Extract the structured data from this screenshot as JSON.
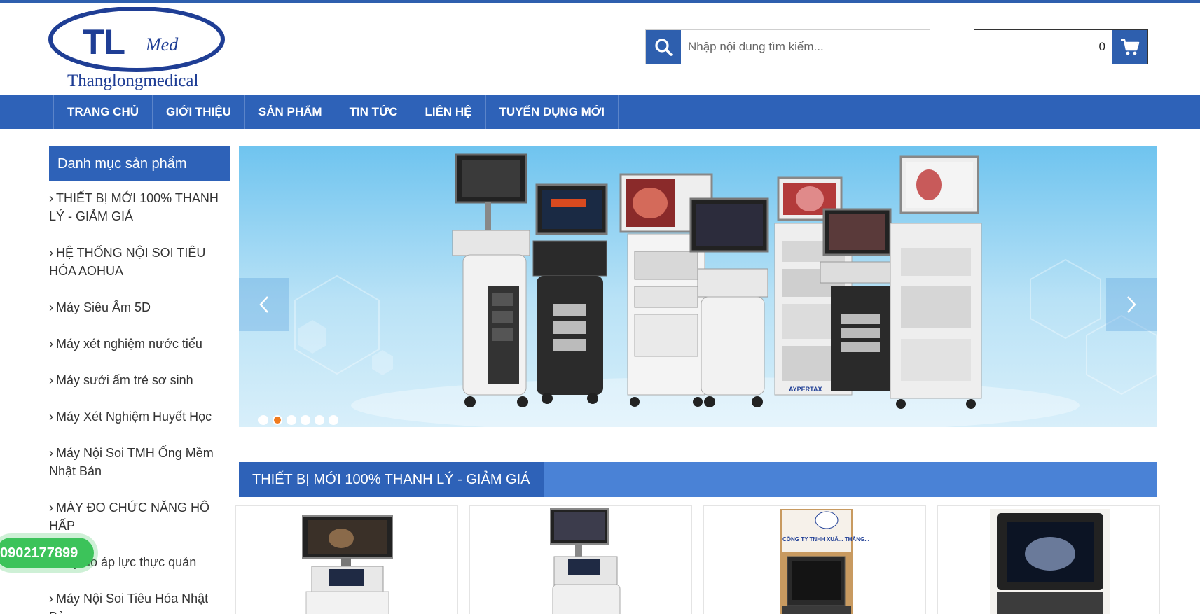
{
  "header": {
    "logo": {
      "initials": "TL",
      "script": "Med",
      "brand": "Thanglongmedical"
    },
    "search": {
      "placeholder": "Nhập nội dung tìm kiếm...",
      "icon": "search-icon"
    },
    "cart": {
      "count": "0",
      "icon": "cart-icon"
    }
  },
  "nav": {
    "items": [
      "TRANG CHỦ",
      "GIỚI THIỆU",
      "SẢN PHẨM",
      "TIN TỨC",
      "LIÊN HỆ",
      "TUYỂN DỤNG MỚI"
    ]
  },
  "sidebar": {
    "title": "Danh mục sản phẩm",
    "items": [
      "THIẾT BỊ MỚI 100% THANH LÝ - GIẢM GIÁ",
      "HỆ THỐNG NỘI SOI TIÊU HÓA AOHUA",
      "Máy Siêu Âm 5D",
      "Máy xét nghiệm nước tiểu",
      "Máy sưởi ấm trẻ sơ sinh",
      "Máy Xét Nghiệm Huyết Học",
      "Máy Nội Soi TMH Ống Mềm Nhật Bản",
      "MÁY ĐO CHỨC NĂNG HÔ HẤP",
      "Máy đo áp lực thực quản",
      "Máy Nội Soi Tiêu Hóa Nhật Bản"
    ]
  },
  "banner": {
    "slide_count": 6,
    "active_slide": 2,
    "brand_mark": "AYPERTAX"
  },
  "section": {
    "title": "THIẾT BỊ MỚI 100% THANH LÝ - GIẢM GIÁ"
  },
  "products": [
    {
      "image": "ultrasound-cart-monitor"
    },
    {
      "image": "ultrasound-cart-compact"
    },
    {
      "image": "laptop-ultrasound-box",
      "sign_text": "CÔNG TY TNHH XUẤ... THĂNG..."
    },
    {
      "image": "portable-ultrasound-screen"
    }
  ],
  "phone": {
    "number": "0902177899"
  },
  "colors": {
    "primary": "#2e62b8",
    "accent": "#4a82d6",
    "phone_green": "#3cc35a",
    "dot_active": "#f07b1e"
  }
}
